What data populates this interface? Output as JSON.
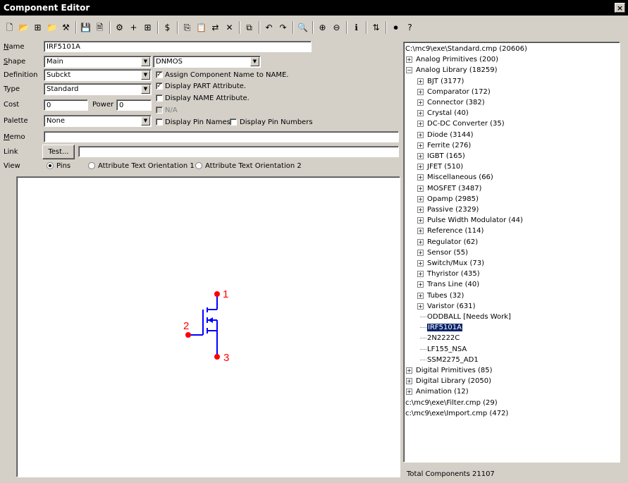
{
  "window": {
    "title": "Component Editor",
    "close_glyph": "×"
  },
  "toolbar": {
    "buttons": [
      {
        "name": "new-icon",
        "glyph": "🗋"
      },
      {
        "name": "open-folder-icon",
        "glyph": "📂"
      },
      {
        "name": "tree-icon",
        "glyph": "⊞"
      },
      {
        "name": "open-icon",
        "glyph": "📁"
      },
      {
        "name": "wand-icon",
        "glyph": "⚒"
      },
      {
        "name": "save-icon",
        "glyph": "💾"
      },
      {
        "name": "document-icon",
        "glyph": "🗎"
      },
      {
        "name": "component-wizard-icon",
        "glyph": "⚙"
      },
      {
        "name": "add-part-icon",
        "glyph": "+"
      },
      {
        "name": "grid-icon",
        "glyph": "⊞"
      },
      {
        "name": "dollar-icon",
        "glyph": "$"
      },
      {
        "name": "copy-icon",
        "glyph": "⎘"
      },
      {
        "name": "paste-icon",
        "glyph": "📋"
      },
      {
        "name": "replace-icon",
        "glyph": "⇄"
      },
      {
        "name": "delete-icon",
        "glyph": "✕"
      },
      {
        "name": "merge-icon",
        "glyph": "⧉"
      },
      {
        "name": "undo-icon",
        "glyph": "↶"
      },
      {
        "name": "redo-icon",
        "glyph": "↷"
      },
      {
        "name": "find-icon",
        "glyph": "🔍"
      },
      {
        "name": "zoom-in-icon",
        "glyph": "⊕"
      },
      {
        "name": "zoom-out-icon",
        "glyph": "⊖"
      },
      {
        "name": "info-icon",
        "glyph": "ℹ"
      },
      {
        "name": "sort-icon",
        "glyph": "⇅"
      },
      {
        "name": "stop-icon",
        "glyph": "⏺"
      },
      {
        "name": "help-icon",
        "glyph": "?"
      }
    ]
  },
  "form": {
    "name_label": "Name",
    "name_value": "IRF5101A",
    "shape_label": "Shape",
    "shape_value": "Main",
    "shape2_value": "DNMOS",
    "definition_label": "Definition",
    "definition_value": "Subckt",
    "type_label": "Type",
    "type_value": "Standard",
    "cost_label": "Cost",
    "cost_value": "0",
    "power_label": "Power",
    "power_value": "0",
    "palette_label": "Palette",
    "palette_value": "None",
    "memo_label": "Memo",
    "memo_value": "",
    "link_label": "Link",
    "link_value": "",
    "test_button": "Test...",
    "view_label": "View",
    "view_options": [
      "Pins",
      "Attribute Text Orientation 1",
      "Attribute Text Orientation 2"
    ],
    "checks": {
      "assign_name": "Assign Component Name to NAME.",
      "display_part": "Display PART Attribute.",
      "display_name": "Display NAME Attribute.",
      "na": "N/A",
      "pin_names": "Display Pin Names",
      "pin_numbers": "Display Pin Numbers"
    }
  },
  "schematic": {
    "pin1": "1",
    "pin2": "2",
    "pin3": "3",
    "wire_color": "#0000ff",
    "pin_color": "#ff0000"
  },
  "tree": {
    "items": [
      {
        "label": "C:\\mc9\\exe\\Standard.cmp (20606)"
      },
      {
        "label": "Analog Primitives (200)"
      },
      {
        "label": "Analog Library (18259)"
      },
      {
        "label": "BJT (3177)"
      },
      {
        "label": "Comparator (172)"
      },
      {
        "label": "Connector (382)"
      },
      {
        "label": "Crystal (40)"
      },
      {
        "label": "DC-DC Converter (35)"
      },
      {
        "label": "Diode (3144)"
      },
      {
        "label": "Ferrite (276)"
      },
      {
        "label": "IGBT (165)"
      },
      {
        "label": "JFET (510)"
      },
      {
        "label": "Miscellaneous (66)"
      },
      {
        "label": "MOSFET (3487)"
      },
      {
        "label": "Opamp (2985)"
      },
      {
        "label": "Passive (2329)"
      },
      {
        "label": "Pulse Width Modulator (44)"
      },
      {
        "label": "Reference (114)"
      },
      {
        "label": "Regulator (62)"
      },
      {
        "label": "Sensor (55)"
      },
      {
        "label": "Switch/Mux (73)"
      },
      {
        "label": "Thyristor (435)"
      },
      {
        "label": "Trans Line (40)"
      },
      {
        "label": "Tubes (32)"
      },
      {
        "label": "Varistor (631)"
      },
      {
        "label": "ODDBALL [Needs Work]"
      },
      {
        "label": "IRF5101A"
      },
      {
        "label": "2N2222C"
      },
      {
        "label": "LF155_NSA"
      },
      {
        "label": "SSM2275_AD1"
      },
      {
        "label": "Digital Primitives (85)"
      },
      {
        "label": "Digital Library (2050)"
      },
      {
        "label": "Animation (12)"
      },
      {
        "label": "c:\\mc9\\exe\\Filter.cmp (29)"
      },
      {
        "label": "c:\\mc9\\exe\\Import.cmp (472)"
      }
    ],
    "total": "Total Components 21107"
  }
}
